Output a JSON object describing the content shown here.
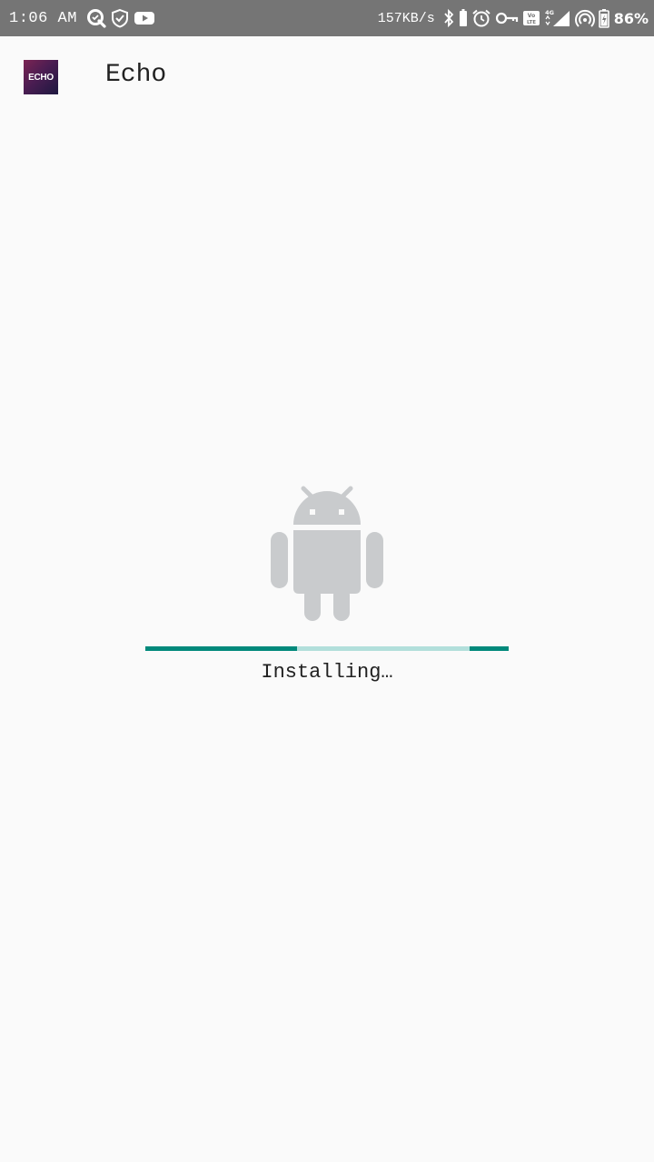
{
  "status_bar": {
    "time": "1:06 AM",
    "net_speed": "157KB/s",
    "battery_percent": "86%",
    "left_icons": [
      "quickmemo-icon",
      "shield-check-icon",
      "youtube-icon"
    ],
    "right_icons": [
      "bluetooth-icon",
      "battery-saver-icon",
      "alarm-icon",
      "vpn-key-icon",
      "volte-icon",
      "signal-4g-icon",
      "hotspot-icon",
      "battery-icon"
    ],
    "volte_label": "Vo LTE",
    "network_label": "4G",
    "background": "#757575"
  },
  "app_bar": {
    "logo_text": "ECHO",
    "title": "Echo"
  },
  "install": {
    "icon": "android-robot-icon",
    "status_text": "Installing…",
    "progress_type": "indeterminate",
    "accent_color": "#00897b",
    "track_color": "#b2dfdb"
  }
}
